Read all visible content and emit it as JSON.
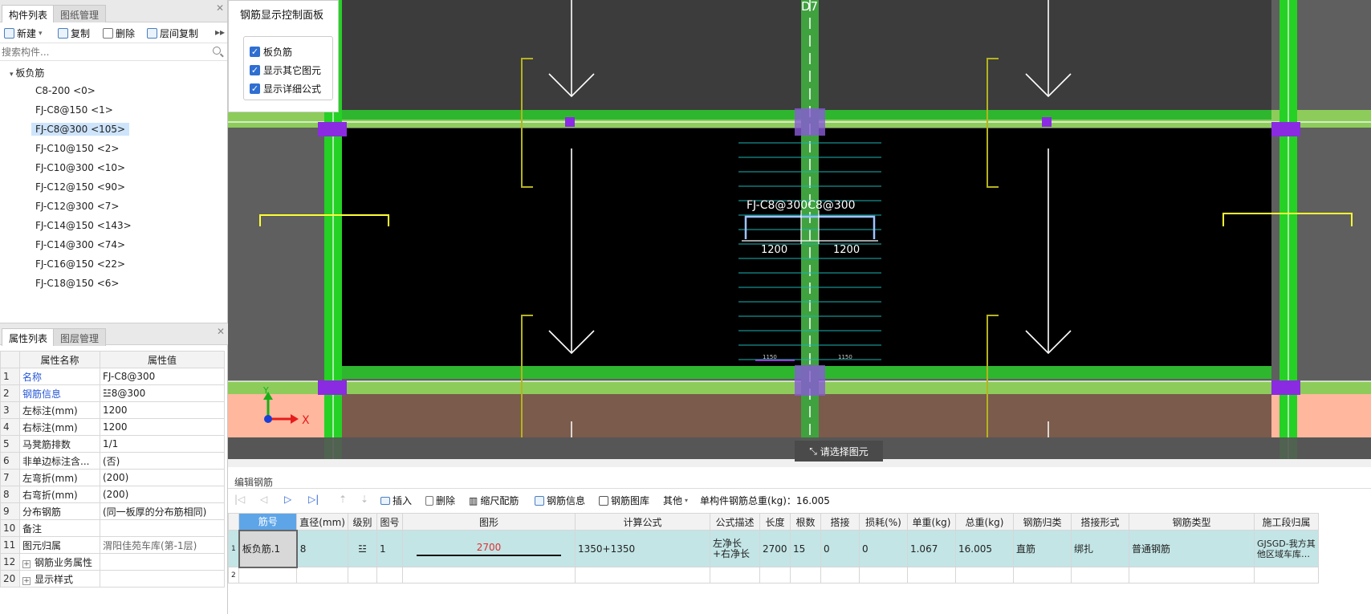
{
  "left": {
    "tabs": [
      "构件列表",
      "图纸管理"
    ],
    "toolbar": {
      "new": "新建",
      "copy": "复制",
      "delete": "删除",
      "floor_copy": "层间复制"
    },
    "search_placeholder": "搜索构件...",
    "tree_root": "板负筋",
    "items": [
      "C8-200 <0>",
      "FJ-C8@150 <1>",
      "FJ-C8@300 <105>",
      "FJ-C10@150 <2>",
      "FJ-C10@300 <10>",
      "FJ-C12@150 <90>",
      "FJ-C12@300 <7>",
      "FJ-C14@150 <143>",
      "FJ-C14@300 <74>",
      "FJ-C16@150 <22>",
      "FJ-C18@150 <6>"
    ],
    "selected_index": 2
  },
  "props": {
    "tabs": [
      "属性列表",
      "图层管理"
    ],
    "col_name": "属性名称",
    "col_value": "属性值",
    "rows": [
      {
        "idx": "1",
        "name": "名称",
        "value": "FJ-C8@300"
      },
      {
        "idx": "2",
        "name": "钢筋信息",
        "value": "☳8@300"
      },
      {
        "idx": "3",
        "name": "左标注(mm)",
        "value": "1200"
      },
      {
        "idx": "4",
        "name": "右标注(mm)",
        "value": "1200"
      },
      {
        "idx": "5",
        "name": "马凳筋排数",
        "value": "1/1"
      },
      {
        "idx": "6",
        "name": "非单边标注含...",
        "value": "(否)"
      },
      {
        "idx": "7",
        "name": "左弯折(mm)",
        "value": "(200)"
      },
      {
        "idx": "8",
        "name": "右弯折(mm)",
        "value": "(200)"
      },
      {
        "idx": "9",
        "name": "分布钢筋",
        "value": "(同一板厚的分布筋相同)"
      },
      {
        "idx": "10",
        "name": "备注",
        "value": ""
      },
      {
        "idx": "11",
        "name": "图元归属",
        "value": "渭阳佳苑车库(第-1层)"
      },
      {
        "idx": "12",
        "name": "钢筋业务属性",
        "value": ""
      },
      {
        "idx": "20",
        "name": "显示样式",
        "value": ""
      }
    ]
  },
  "control_panel": {
    "title": "钢筋显示控制面板",
    "options": [
      "板负筋",
      "显示其它图元",
      "显示详细公式"
    ]
  },
  "canvas": {
    "axis_label": "D7",
    "rebar_label": "FJ-C8@300C8@300",
    "dim_left": "1200",
    "dim_right": "1200",
    "small_left": "1150",
    "small_right": "1150",
    "axis_x": "X",
    "axis_y": "Y",
    "hint": "请选择图元"
  },
  "editor": {
    "title": "编辑钢筋",
    "insert": "插入",
    "delete": "删除",
    "scale": "缩尺配筋",
    "info": "钢筋信息",
    "library": "钢筋图库",
    "other": "其他",
    "total": "单构件钢筋总重(kg)：16.005",
    "headers": [
      "筋号",
      "直径(mm)",
      "级别",
      "图号",
      "图形",
      "计算公式",
      "公式描述",
      "长度",
      "根数",
      "搭接",
      "损耗(%)",
      "单重(kg)",
      "总重(kg)",
      "钢筋归类",
      "搭接形式",
      "钢筋类型",
      "施工段归属"
    ],
    "row": {
      "no": "1",
      "name": "板负筋.1",
      "dia": "8",
      "grade": "☳",
      "fig": "1",
      "shape_len": "2700",
      "formula": "1350+1350",
      "desc": "左净长+右净长",
      "length": "2700",
      "count": "15",
      "lap": "0",
      "loss": "0",
      "unit_w": "1.067",
      "total_w": "16.005",
      "category": "直筋",
      "lap_form": "绑扎",
      "type": "普通钢筋",
      "section": "GJSGD-我方其他区域车库…"
    },
    "row2_no": "2"
  }
}
